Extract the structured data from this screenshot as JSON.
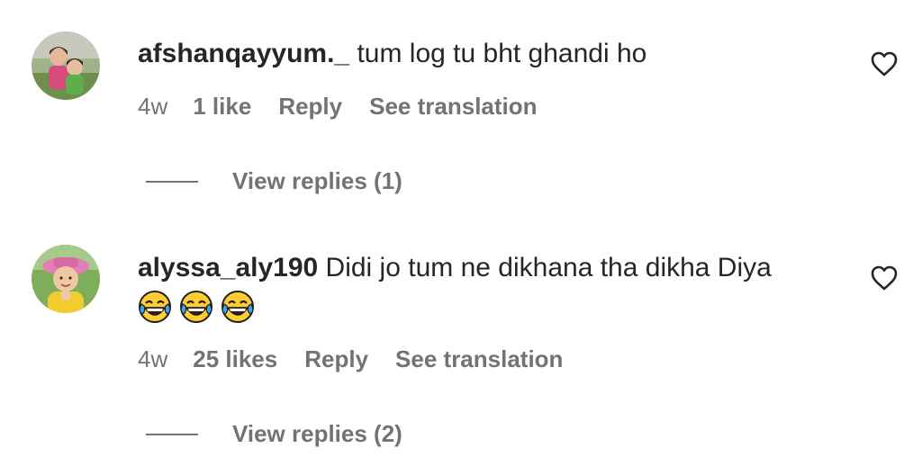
{
  "comments": [
    {
      "username": "afshanqayyum._",
      "text": "tum log tu bht ghandi ho",
      "time": "4w",
      "likes": "1 like",
      "reply_label": "Reply",
      "translate_label": "See translation",
      "view_replies": "View replies (1)",
      "avatar_icon": "avatar-photo-two-girls"
    },
    {
      "username": "alyssa_aly190",
      "text": "Didi jo tum ne dikhana tha dikha Diya",
      "emojis": [
        "face-with-tears-of-joy",
        "face-with-tears-of-joy",
        "face-with-tears-of-joy"
      ],
      "time": "4w",
      "likes": "25 likes",
      "reply_label": "Reply",
      "translate_label": "See translation",
      "view_replies": "View replies (2)",
      "avatar_icon": "avatar-photo-baby-pink-hat"
    }
  ],
  "colors": {
    "primary_text": "#262626",
    "secondary_text": "#737373",
    "background": "#ffffff"
  }
}
